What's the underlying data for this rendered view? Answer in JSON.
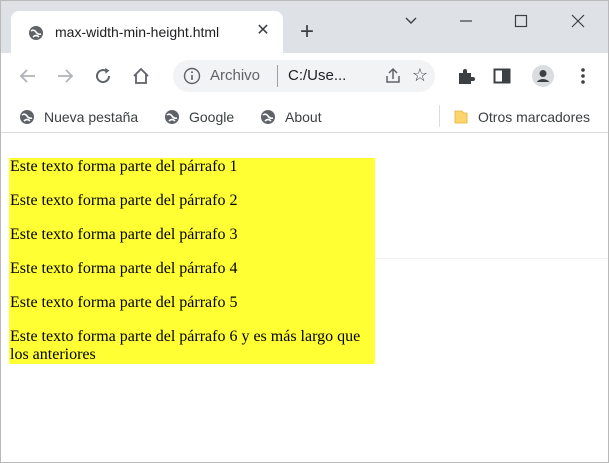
{
  "tab": {
    "title": "max-width-min-height.html",
    "close": "✕",
    "new_tab": "+"
  },
  "window_controls": {
    "menu": "⌄",
    "minimize": "—",
    "maximize": "☐",
    "close": "✕"
  },
  "toolbar": {
    "back": "←",
    "forward": "→",
    "reload": "C",
    "home": "⌂",
    "scheme": "Archivo",
    "url": "C:/Use...",
    "star": "☆",
    "menu": "⋮"
  },
  "bookmarks": [
    {
      "label": "Nueva pestaña"
    },
    {
      "label": "Google"
    },
    {
      "label": "About"
    }
  ],
  "other_bookmarks": "Otros marcadores",
  "paragraphs": [
    "Este texto forma parte del párrafo 1",
    "Este texto forma parte del párrafo 2",
    "Este texto forma parte del párrafo 3",
    "Este texto forma parte del párrafo 4",
    "Este texto forma parte del párrafo 5",
    "Este texto forma parte del párrafo 6 y es más largo que los anteriores"
  ],
  "colors": {
    "box_background": "#ffff33",
    "tabstrip": "#dee1e6"
  }
}
